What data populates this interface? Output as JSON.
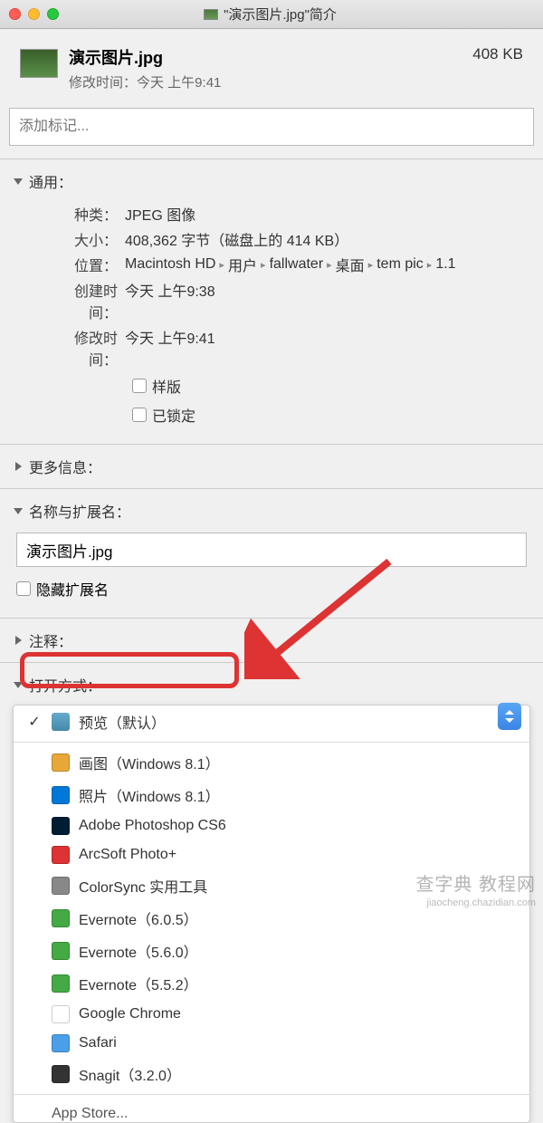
{
  "window": {
    "title": "\"演示图片.jpg\"简介"
  },
  "header": {
    "filename": "演示图片.jpg",
    "modified_label": "修改时间：",
    "modified_value": "今天 上午9:41",
    "size": "408 KB"
  },
  "tags": {
    "placeholder": "添加标记..."
  },
  "sections": {
    "general": {
      "title": "通用：",
      "kind_label": "种类：",
      "kind_value": "JPEG 图像",
      "size_label": "大小：",
      "size_value": "408,362 字节（磁盘上的 414 KB）",
      "where_label": "位置：",
      "where_parts": [
        "Macintosh HD",
        "用户",
        "fallwater",
        "桌面",
        "tem pic",
        "1.1"
      ],
      "created_label": "创建时间：",
      "created_value": "今天 上午9:38",
      "modified_label": "修改时间：",
      "modified_value": "今天 上午9:41",
      "stationery_label": "样版",
      "locked_label": "已锁定"
    },
    "more_info": {
      "title": "更多信息："
    },
    "name_ext": {
      "title": "名称与扩展名：",
      "value": "演示图片.jpg",
      "hide_ext_label": "隐藏扩展名"
    },
    "comments": {
      "title": "注释："
    },
    "open_with": {
      "title": "打开方式：",
      "default_app": "预览（默认）",
      "apps": [
        {
          "name": "画图（Windows 8.1）",
          "color": "#e8a838"
        },
        {
          "name": "照片（Windows 8.1）",
          "color": "#0078d7"
        },
        {
          "name": "Adobe Photoshop CS6",
          "color": "#001d34"
        },
        {
          "name": "ArcSoft Photo+",
          "color": "#d33"
        },
        {
          "name": "ColorSync 实用工具",
          "color": "#888"
        },
        {
          "name": "Evernote（6.0.5）",
          "color": "#4a4"
        },
        {
          "name": "Evernote（5.6.0）",
          "color": "#4a4"
        },
        {
          "name": "Evernote（5.5.2）",
          "color": "#4a4"
        },
        {
          "name": "Google Chrome",
          "color": "#fff"
        },
        {
          "name": "Safari",
          "color": "#4aa0e8"
        },
        {
          "name": "Snagit（3.2.0）",
          "color": "#333"
        }
      ],
      "app_store": "App Store..."
    }
  },
  "watermark": {
    "main": "查字典 教程网",
    "sub": "jiaocheng.chazidian.com"
  }
}
